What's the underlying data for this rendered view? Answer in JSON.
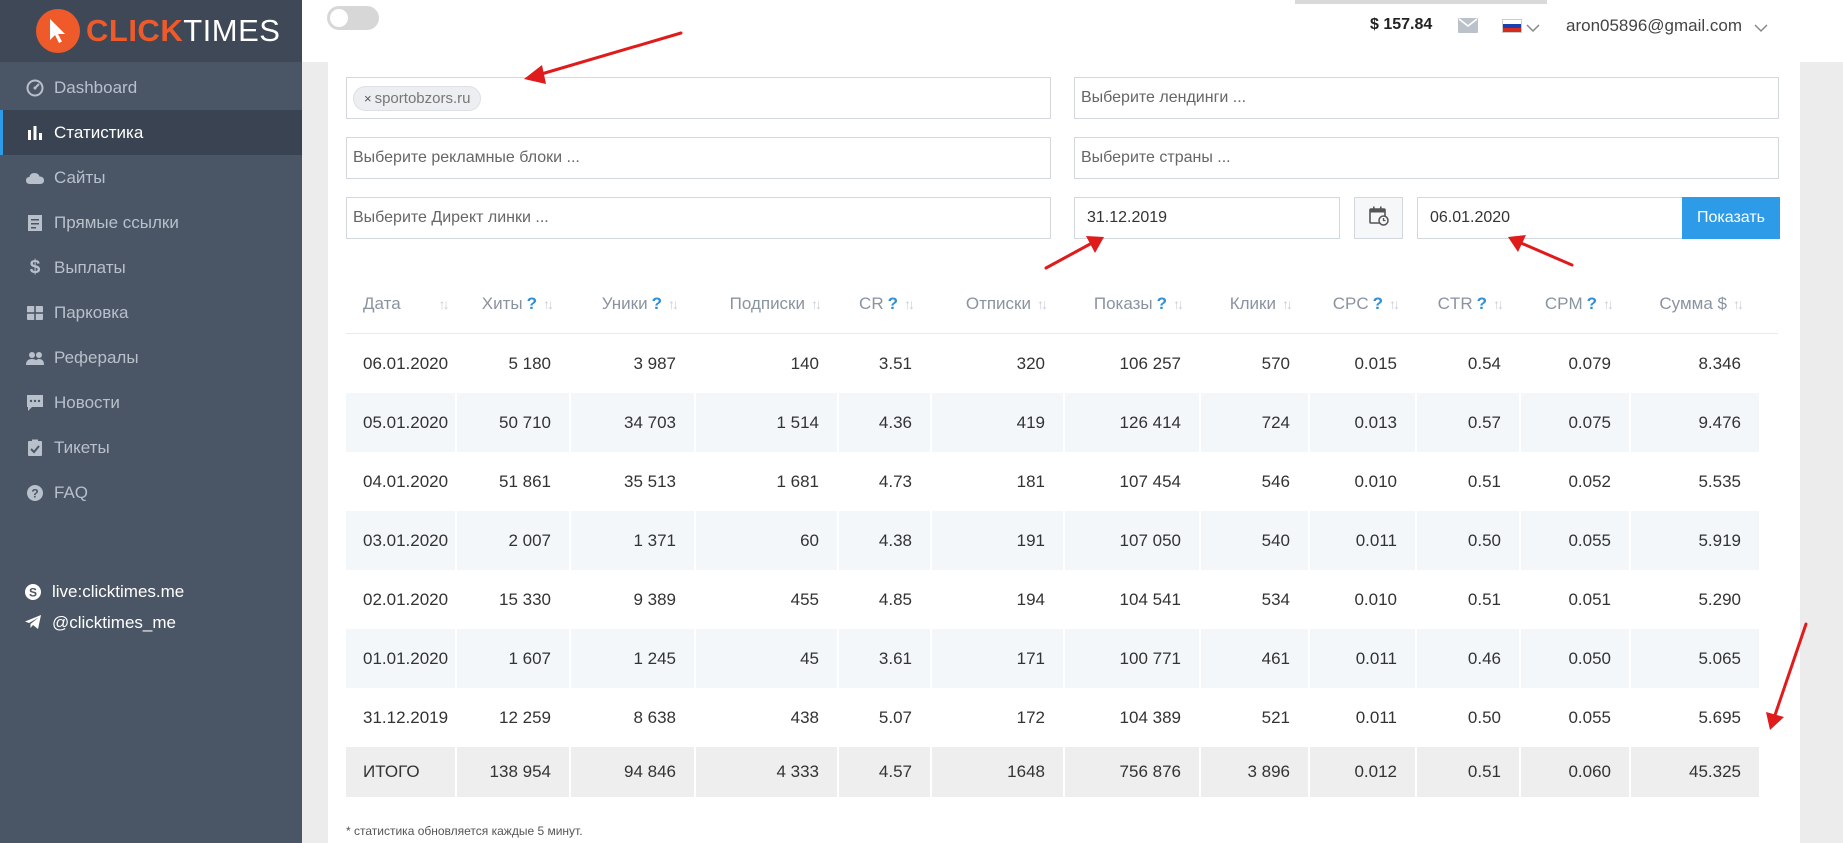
{
  "logo": {
    "part1": "CLICK",
    "part2": "TIMES"
  },
  "sidebar": {
    "items": [
      {
        "label": "Dashboard",
        "icon": "dashboard-icon"
      },
      {
        "label": "Статистика",
        "icon": "bar-chart-icon",
        "active": true
      },
      {
        "label": "Сайты",
        "icon": "cloud-icon"
      },
      {
        "label": "Прямые ссылки",
        "icon": "document-icon"
      },
      {
        "label": "Выплаты",
        "icon": "dollar-icon"
      },
      {
        "label": "Парковка",
        "icon": "grid-icon"
      },
      {
        "label": "Рефералы",
        "icon": "users-icon"
      },
      {
        "label": "Новости",
        "icon": "comment-icon"
      },
      {
        "label": "Тикеты",
        "icon": "clipboard-check-icon"
      },
      {
        "label": "FAQ",
        "icon": "question-icon"
      }
    ],
    "social": [
      {
        "label": "live:clicktimes.me",
        "icon": "skype-icon"
      },
      {
        "label": "@clicktimes_me",
        "icon": "telegram-icon"
      }
    ]
  },
  "header": {
    "balance": "$ 157.84",
    "email": "aron05896@gmail.com",
    "language_flag": "russian-flag-icon"
  },
  "filters": {
    "site_tag": "sportobzors.ru",
    "site_tag_remove": "×",
    "landings_placeholder": "Выберите лендинги ...",
    "ad_blocks_placeholder": "Выберите рекламные блоки ...",
    "countries_placeholder": "Выберите страны ...",
    "direct_links_placeholder": "Выберите Директ линки ...",
    "date_from": "31.12.2019",
    "date_to": "06.01.2020",
    "show_button": "Показать"
  },
  "table": {
    "columns": [
      {
        "label": "Дата",
        "help": false
      },
      {
        "label": "Хиты",
        "help": true
      },
      {
        "label": "Уники",
        "help": true
      },
      {
        "label": "Подписки",
        "help": false
      },
      {
        "label": "CR",
        "help": true
      },
      {
        "label": "Отписки",
        "help": false
      },
      {
        "label": "Показы",
        "help": true
      },
      {
        "label": "Клики",
        "help": false
      },
      {
        "label": "CPC",
        "help": true
      },
      {
        "label": "CTR",
        "help": true
      },
      {
        "label": "CPM",
        "help": true
      },
      {
        "label": "Сумма $",
        "help": false
      }
    ],
    "help_mark": "?",
    "sort_mark": "↑↓",
    "rows": [
      [
        "06.01.2020",
        "5 180",
        "3 987",
        "140",
        "3.51",
        "320",
        "106 257",
        "570",
        "0.015",
        "0.54",
        "0.079",
        "8.346"
      ],
      [
        "05.01.2020",
        "50 710",
        "34 703",
        "1 514",
        "4.36",
        "419",
        "126 414",
        "724",
        "0.013",
        "0.57",
        "0.075",
        "9.476"
      ],
      [
        "04.01.2020",
        "51 861",
        "35 513",
        "1 681",
        "4.73",
        "181",
        "107 454",
        "546",
        "0.010",
        "0.51",
        "0.052",
        "5.535"
      ],
      [
        "03.01.2020",
        "2 007",
        "1 371",
        "60",
        "4.38",
        "191",
        "107 050",
        "540",
        "0.011",
        "0.50",
        "0.055",
        "5.919"
      ],
      [
        "02.01.2020",
        "15 330",
        "9 389",
        "455",
        "4.85",
        "194",
        "104 541",
        "534",
        "0.010",
        "0.51",
        "0.051",
        "5.290"
      ],
      [
        "01.01.2020",
        "1 607",
        "1 245",
        "45",
        "3.61",
        "171",
        "100 771",
        "461",
        "0.011",
        "0.46",
        "0.050",
        "5.065"
      ],
      [
        "31.12.2019",
        "12 259",
        "8 638",
        "438",
        "5.07",
        "172",
        "104 389",
        "521",
        "0.011",
        "0.50",
        "0.055",
        "5.695"
      ]
    ],
    "total": [
      "ИТОГО",
      "138 954",
      "94 846",
      "4 333",
      "4.57",
      "1648",
      "756 876",
      "3 896",
      "0.012",
      "0.51",
      "0.060",
      "45.325"
    ]
  },
  "footnote": "* статистика обновляется каждые 5 минут.",
  "colors": {
    "accent": "#2d9be8",
    "logo": "#ee5a2a",
    "sidebar": "#4a5565",
    "annotation": "#e01b1b"
  }
}
